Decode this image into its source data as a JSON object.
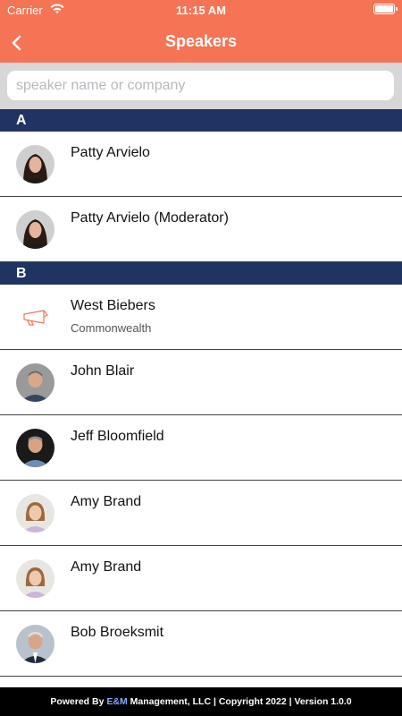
{
  "status_bar": {
    "carrier": "Carrier",
    "time": "11:15 AM"
  },
  "header": {
    "title": "Speakers",
    "back_icon": "chevron-left-icon"
  },
  "search": {
    "placeholder": "speaker name or company",
    "value": ""
  },
  "sections": [
    {
      "letter": "A",
      "speakers": [
        {
          "name": "Patty Arvielo",
          "company": "",
          "avatar": "photo"
        },
        {
          "name": "Patty Arvielo (Moderator)",
          "company": "",
          "avatar": "photo"
        }
      ]
    },
    {
      "letter": "B",
      "speakers": [
        {
          "name": "West Biebers",
          "company": "Commonwealth",
          "avatar": "megaphone-icon"
        },
        {
          "name": "John Blair",
          "company": "",
          "avatar": "photo"
        },
        {
          "name": "Jeff Bloomfield",
          "company": "",
          "avatar": "photo"
        },
        {
          "name": "Amy Brand",
          "company": "",
          "avatar": "photo"
        },
        {
          "name": "Amy Brand",
          "company": "",
          "avatar": "photo"
        },
        {
          "name": "Bob Broeksmit",
          "company": "",
          "avatar": "photo"
        }
      ]
    }
  ],
  "footer": {
    "prefix": "Powered By ",
    "brand": "E&M",
    "suffix": " Management, LLC | Copyright 2022 | Version 1.0.0"
  },
  "colors": {
    "header": "#f47455",
    "section": "#1f3462",
    "footer": "#000000"
  }
}
